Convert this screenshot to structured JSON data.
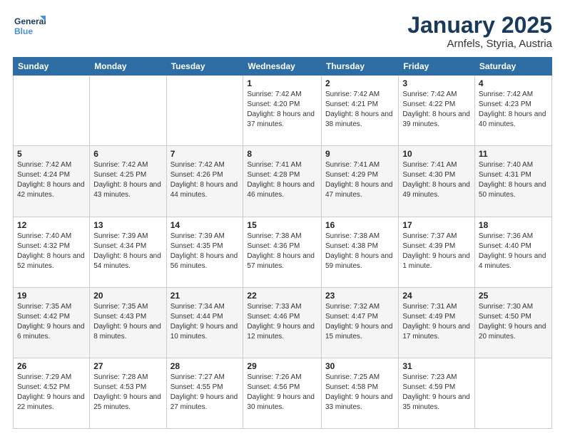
{
  "logo": {
    "line1": "General",
    "line2": "Blue"
  },
  "title": "January 2025",
  "subtitle": "Arnfels, Styria, Austria",
  "weekdays": [
    "Sunday",
    "Monday",
    "Tuesday",
    "Wednesday",
    "Thursday",
    "Friday",
    "Saturday"
  ],
  "weeks": [
    [
      {
        "day": "",
        "sunrise": "",
        "sunset": "",
        "daylight": ""
      },
      {
        "day": "",
        "sunrise": "",
        "sunset": "",
        "daylight": ""
      },
      {
        "day": "",
        "sunrise": "",
        "sunset": "",
        "daylight": ""
      },
      {
        "day": "1",
        "sunrise": "Sunrise: 7:42 AM",
        "sunset": "Sunset: 4:20 PM",
        "daylight": "Daylight: 8 hours and 37 minutes."
      },
      {
        "day": "2",
        "sunrise": "Sunrise: 7:42 AM",
        "sunset": "Sunset: 4:21 PM",
        "daylight": "Daylight: 8 hours and 38 minutes."
      },
      {
        "day": "3",
        "sunrise": "Sunrise: 7:42 AM",
        "sunset": "Sunset: 4:22 PM",
        "daylight": "Daylight: 8 hours and 39 minutes."
      },
      {
        "day": "4",
        "sunrise": "Sunrise: 7:42 AM",
        "sunset": "Sunset: 4:23 PM",
        "daylight": "Daylight: 8 hours and 40 minutes."
      }
    ],
    [
      {
        "day": "5",
        "sunrise": "Sunrise: 7:42 AM",
        "sunset": "Sunset: 4:24 PM",
        "daylight": "Daylight: 8 hours and 42 minutes."
      },
      {
        "day": "6",
        "sunrise": "Sunrise: 7:42 AM",
        "sunset": "Sunset: 4:25 PM",
        "daylight": "Daylight: 8 hours and 43 minutes."
      },
      {
        "day": "7",
        "sunrise": "Sunrise: 7:42 AM",
        "sunset": "Sunset: 4:26 PM",
        "daylight": "Daylight: 8 hours and 44 minutes."
      },
      {
        "day": "8",
        "sunrise": "Sunrise: 7:41 AM",
        "sunset": "Sunset: 4:28 PM",
        "daylight": "Daylight: 8 hours and 46 minutes."
      },
      {
        "day": "9",
        "sunrise": "Sunrise: 7:41 AM",
        "sunset": "Sunset: 4:29 PM",
        "daylight": "Daylight: 8 hours and 47 minutes."
      },
      {
        "day": "10",
        "sunrise": "Sunrise: 7:41 AM",
        "sunset": "Sunset: 4:30 PM",
        "daylight": "Daylight: 8 hours and 49 minutes."
      },
      {
        "day": "11",
        "sunrise": "Sunrise: 7:40 AM",
        "sunset": "Sunset: 4:31 PM",
        "daylight": "Daylight: 8 hours and 50 minutes."
      }
    ],
    [
      {
        "day": "12",
        "sunrise": "Sunrise: 7:40 AM",
        "sunset": "Sunset: 4:32 PM",
        "daylight": "Daylight: 8 hours and 52 minutes."
      },
      {
        "day": "13",
        "sunrise": "Sunrise: 7:39 AM",
        "sunset": "Sunset: 4:34 PM",
        "daylight": "Daylight: 8 hours and 54 minutes."
      },
      {
        "day": "14",
        "sunrise": "Sunrise: 7:39 AM",
        "sunset": "Sunset: 4:35 PM",
        "daylight": "Daylight: 8 hours and 56 minutes."
      },
      {
        "day": "15",
        "sunrise": "Sunrise: 7:38 AM",
        "sunset": "Sunset: 4:36 PM",
        "daylight": "Daylight: 8 hours and 57 minutes."
      },
      {
        "day": "16",
        "sunrise": "Sunrise: 7:38 AM",
        "sunset": "Sunset: 4:38 PM",
        "daylight": "Daylight: 8 hours and 59 minutes."
      },
      {
        "day": "17",
        "sunrise": "Sunrise: 7:37 AM",
        "sunset": "Sunset: 4:39 PM",
        "daylight": "Daylight: 9 hours and 1 minute."
      },
      {
        "day": "18",
        "sunrise": "Sunrise: 7:36 AM",
        "sunset": "Sunset: 4:40 PM",
        "daylight": "Daylight: 9 hours and 4 minutes."
      }
    ],
    [
      {
        "day": "19",
        "sunrise": "Sunrise: 7:35 AM",
        "sunset": "Sunset: 4:42 PM",
        "daylight": "Daylight: 9 hours and 6 minutes."
      },
      {
        "day": "20",
        "sunrise": "Sunrise: 7:35 AM",
        "sunset": "Sunset: 4:43 PM",
        "daylight": "Daylight: 9 hours and 8 minutes."
      },
      {
        "day": "21",
        "sunrise": "Sunrise: 7:34 AM",
        "sunset": "Sunset: 4:44 PM",
        "daylight": "Daylight: 9 hours and 10 minutes."
      },
      {
        "day": "22",
        "sunrise": "Sunrise: 7:33 AM",
        "sunset": "Sunset: 4:46 PM",
        "daylight": "Daylight: 9 hours and 12 minutes."
      },
      {
        "day": "23",
        "sunrise": "Sunrise: 7:32 AM",
        "sunset": "Sunset: 4:47 PM",
        "daylight": "Daylight: 9 hours and 15 minutes."
      },
      {
        "day": "24",
        "sunrise": "Sunrise: 7:31 AM",
        "sunset": "Sunset: 4:49 PM",
        "daylight": "Daylight: 9 hours and 17 minutes."
      },
      {
        "day": "25",
        "sunrise": "Sunrise: 7:30 AM",
        "sunset": "Sunset: 4:50 PM",
        "daylight": "Daylight: 9 hours and 20 minutes."
      }
    ],
    [
      {
        "day": "26",
        "sunrise": "Sunrise: 7:29 AM",
        "sunset": "Sunset: 4:52 PM",
        "daylight": "Daylight: 9 hours and 22 minutes."
      },
      {
        "day": "27",
        "sunrise": "Sunrise: 7:28 AM",
        "sunset": "Sunset: 4:53 PM",
        "daylight": "Daylight: 9 hours and 25 minutes."
      },
      {
        "day": "28",
        "sunrise": "Sunrise: 7:27 AM",
        "sunset": "Sunset: 4:55 PM",
        "daylight": "Daylight: 9 hours and 27 minutes."
      },
      {
        "day": "29",
        "sunrise": "Sunrise: 7:26 AM",
        "sunset": "Sunset: 4:56 PM",
        "daylight": "Daylight: 9 hours and 30 minutes."
      },
      {
        "day": "30",
        "sunrise": "Sunrise: 7:25 AM",
        "sunset": "Sunset: 4:58 PM",
        "daylight": "Daylight: 9 hours and 33 minutes."
      },
      {
        "day": "31",
        "sunrise": "Sunrise: 7:23 AM",
        "sunset": "Sunset: 4:59 PM",
        "daylight": "Daylight: 9 hours and 35 minutes."
      },
      {
        "day": "",
        "sunrise": "",
        "sunset": "",
        "daylight": ""
      }
    ]
  ]
}
